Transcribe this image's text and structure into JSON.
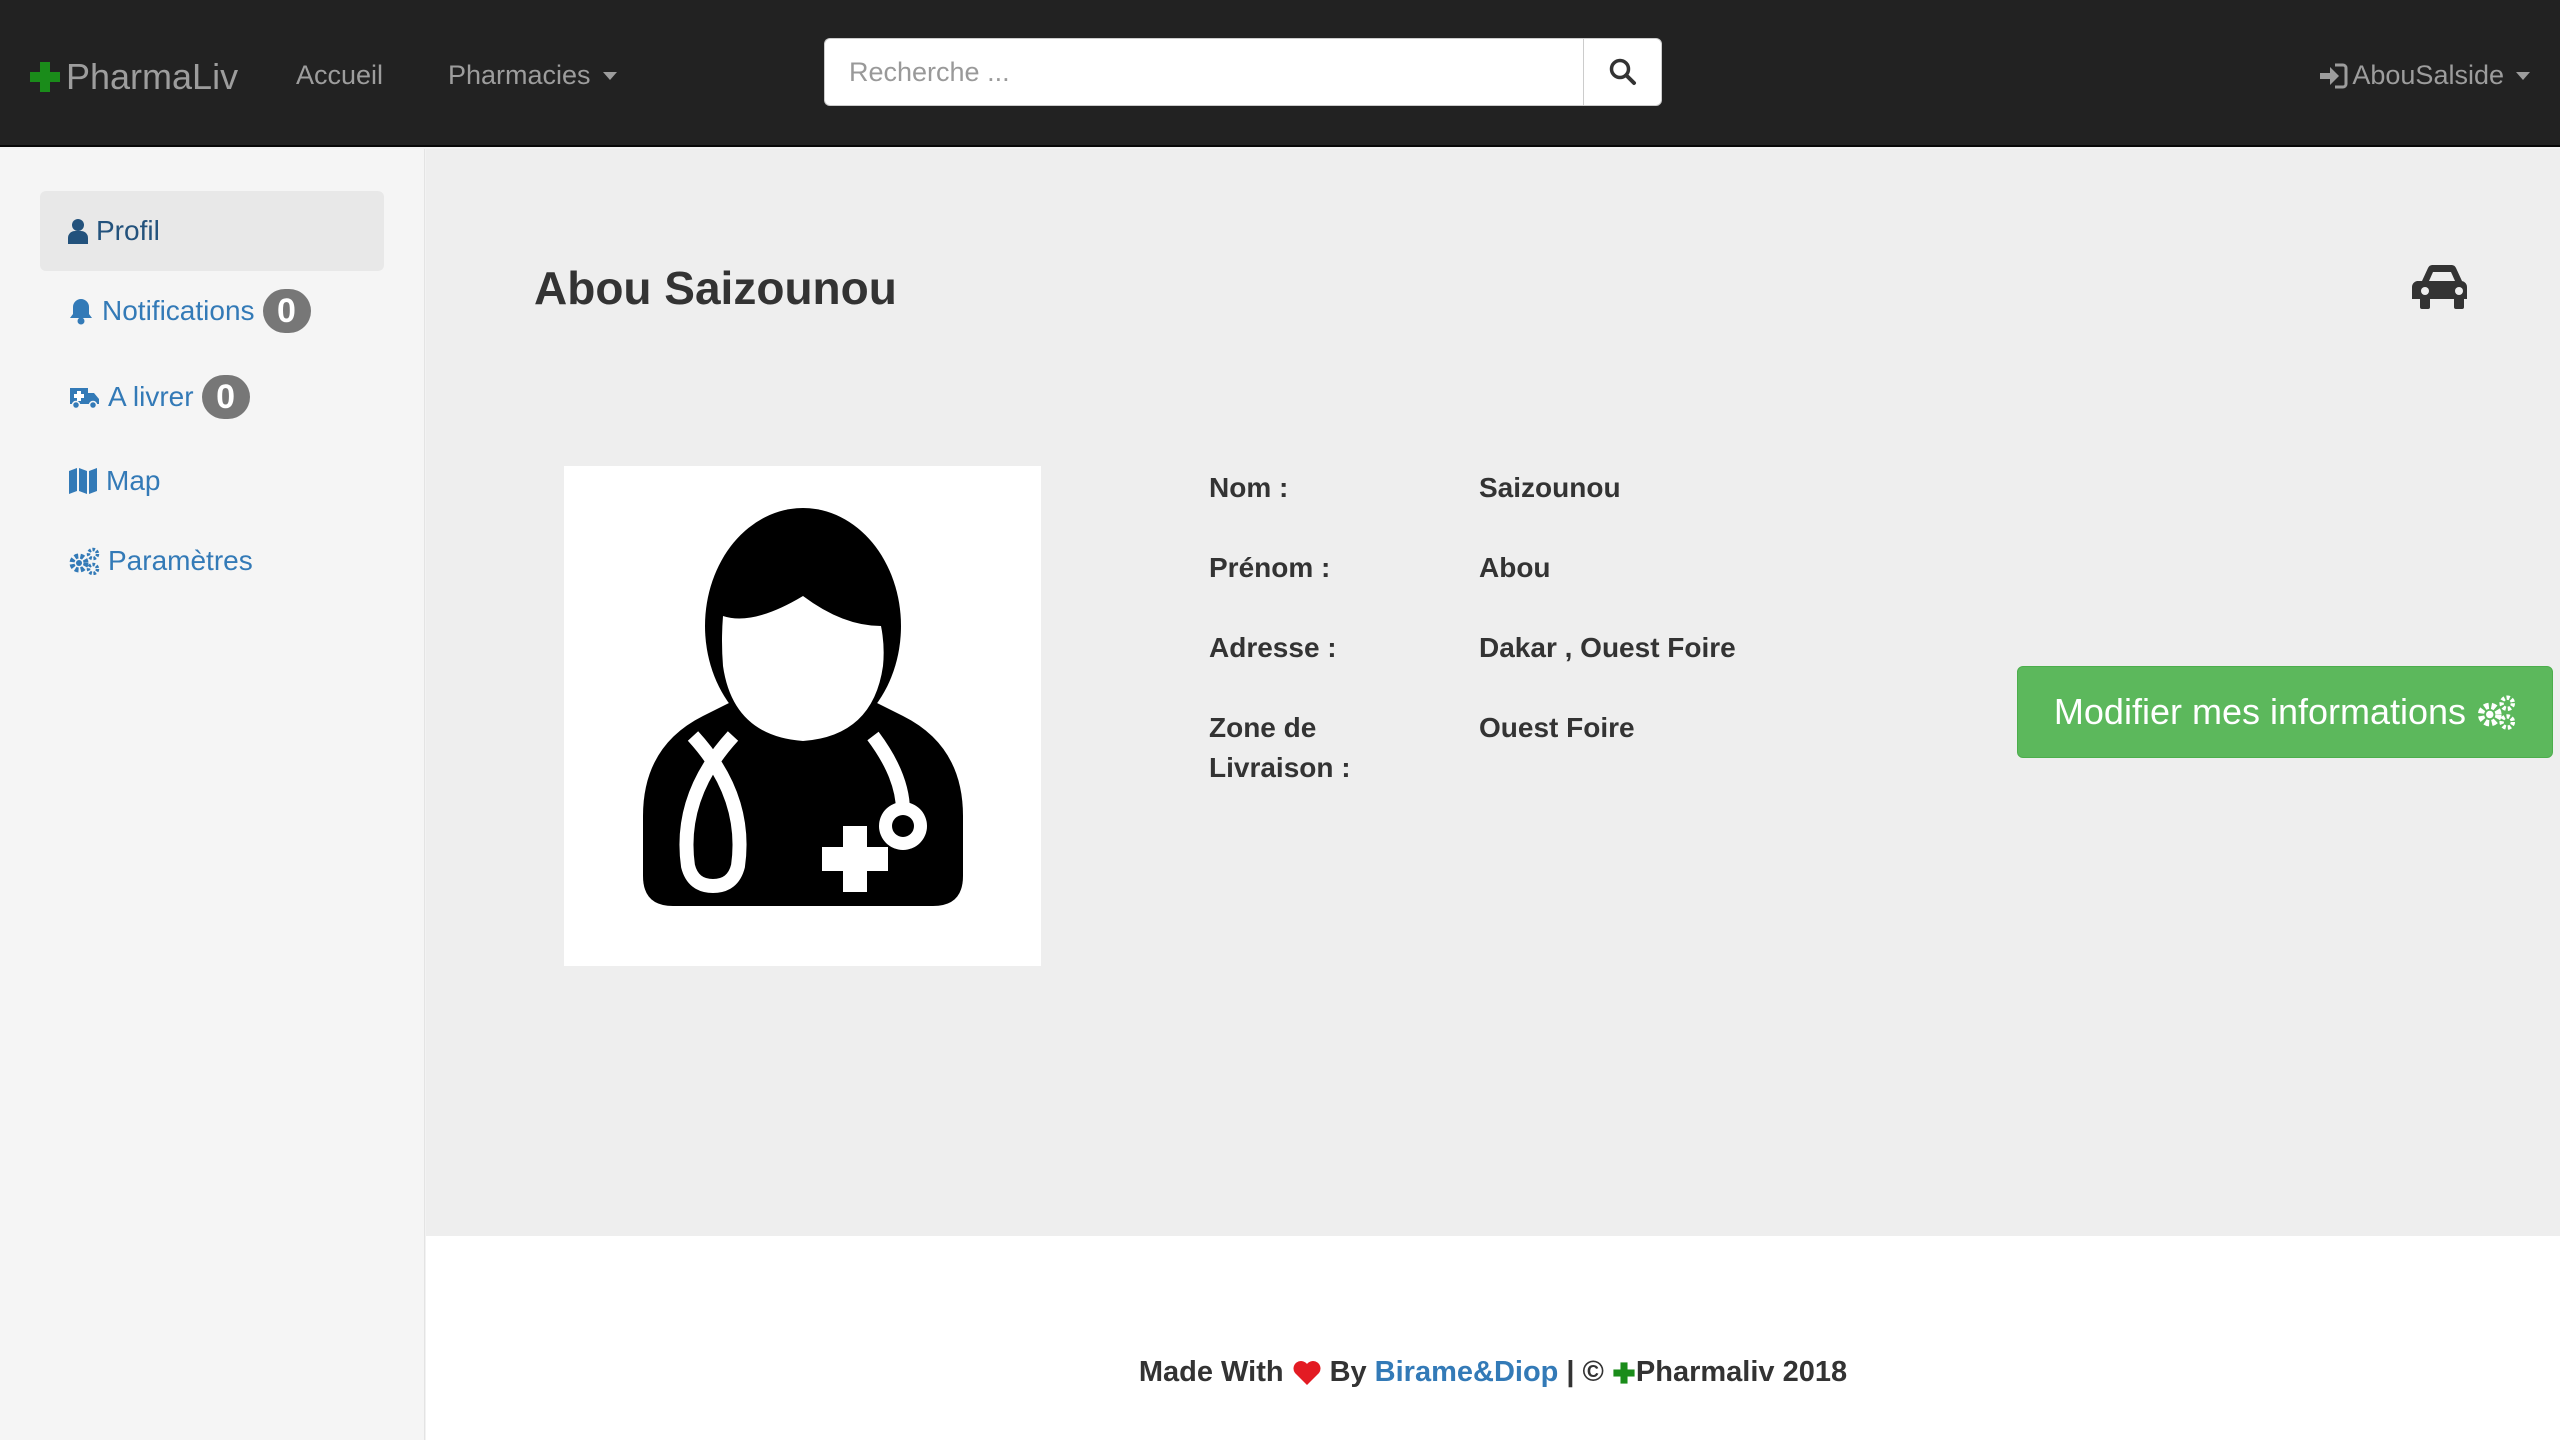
{
  "colors": {
    "navbar_bg": "#222222",
    "brand_green": "#1a8c1a",
    "link_blue": "#337ab7",
    "success_green": "#5cb85c",
    "heart_red": "#e31b23"
  },
  "navbar": {
    "brand": "PharmaLiv",
    "brand_icon": "plus-icon",
    "links": [
      {
        "label": "Accueil"
      },
      {
        "label": "Pharmacies",
        "has_dropdown": true
      }
    ],
    "search": {
      "placeholder": "Recherche ...",
      "value": "",
      "icon": "search-icon"
    },
    "user": {
      "label": "AbouSalside",
      "icon": "sign-in-icon",
      "has_dropdown": true
    }
  },
  "sidebar": {
    "items": [
      {
        "label": "Profil",
        "icon": "user-icon",
        "active": true
      },
      {
        "label": "Notifications",
        "icon": "bell-icon",
        "badge": "0"
      },
      {
        "label": "A livrer",
        "icon": "ambulance-icon",
        "badge": "0"
      },
      {
        "label": "Map",
        "icon": "map-icon"
      },
      {
        "label": "Paramètres",
        "icon": "cogs-icon"
      }
    ]
  },
  "profile": {
    "name": "Abou Saizounou",
    "header_icon": "car-icon",
    "avatar_icon": "doctor-avatar-icon",
    "fields": [
      {
        "label": "Nom :",
        "value": "Saizounou"
      },
      {
        "label": "Prénom :",
        "value": "Abou"
      },
      {
        "label": "Adresse :",
        "value": "Dakar , Ouest Foire"
      },
      {
        "label": "Zone de Livraison :",
        "value": "Ouest Foire"
      }
    ],
    "edit_button": "Modifier mes informations",
    "edit_icon": "cogs-icon"
  },
  "footer": {
    "made_with": "Made With",
    "by": "By",
    "author": "Birame&Diop",
    "separator": "| ©",
    "brand": "Pharmaliv 2018"
  }
}
